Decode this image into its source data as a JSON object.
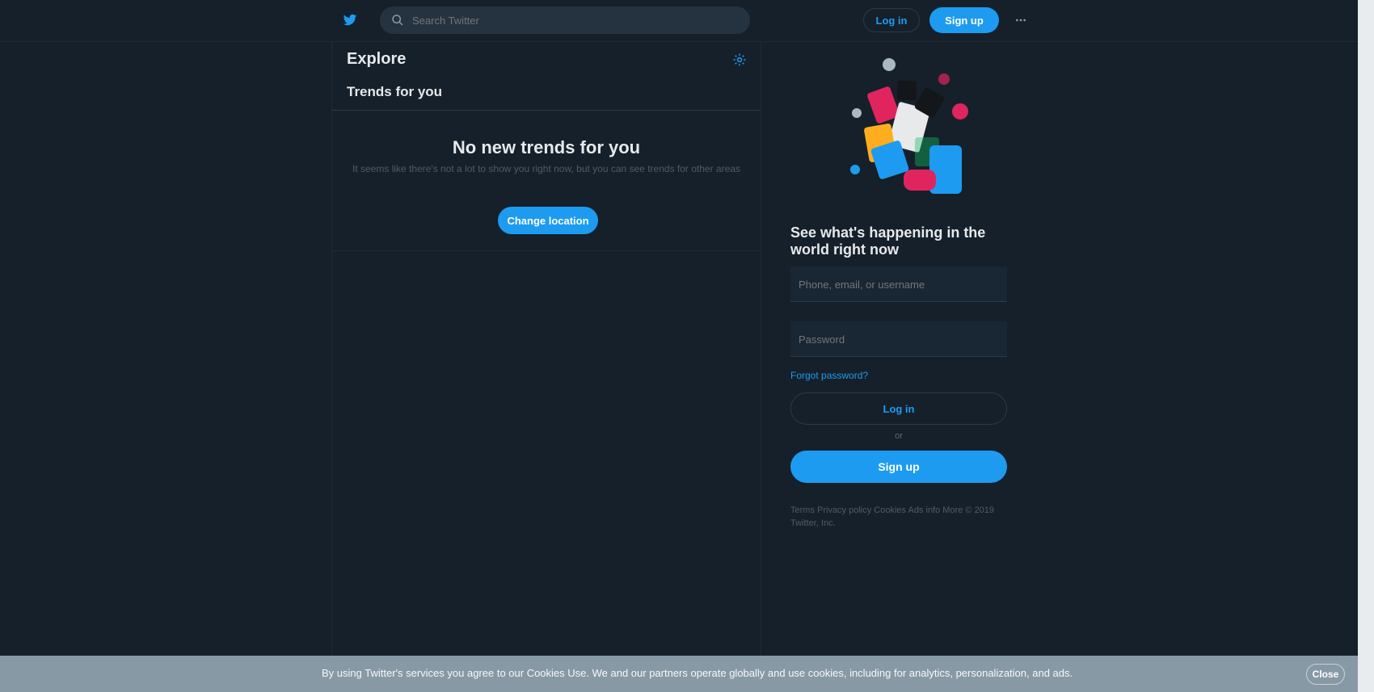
{
  "topbar": {
    "search_placeholder": "Search Twitter",
    "login_label": "Log in",
    "signup_label": "Sign up"
  },
  "main": {
    "title": "Explore",
    "tab_label": "Trends for you",
    "empty_title": "No new trends for you",
    "empty_desc": "It seems like there's not a lot to show you right now, but you can see trends for other areas",
    "reload_label": "Change location"
  },
  "sidebar": {
    "promo_title": "See what's happening in the world right now",
    "phone_placeholder": "Phone, email, or username",
    "password_placeholder": "Password",
    "forgot_label": "Forgot password?",
    "login_label": "Log in",
    "or_label": "or",
    "signup_label": "Sign up",
    "footer_text": "Terms  Privacy policy  Cookies  Ads info  More  © 2019 Twitter, Inc."
  },
  "banner": {
    "text": "By using Twitter's services you agree to our Cookies Use. We and our partners operate globally and use cookies, including for analytics, personalization, and ads.",
    "close_label": "Close"
  },
  "colors": {
    "background": "#15202b",
    "accent": "#1d9bf0",
    "banner": "#8899a6"
  }
}
